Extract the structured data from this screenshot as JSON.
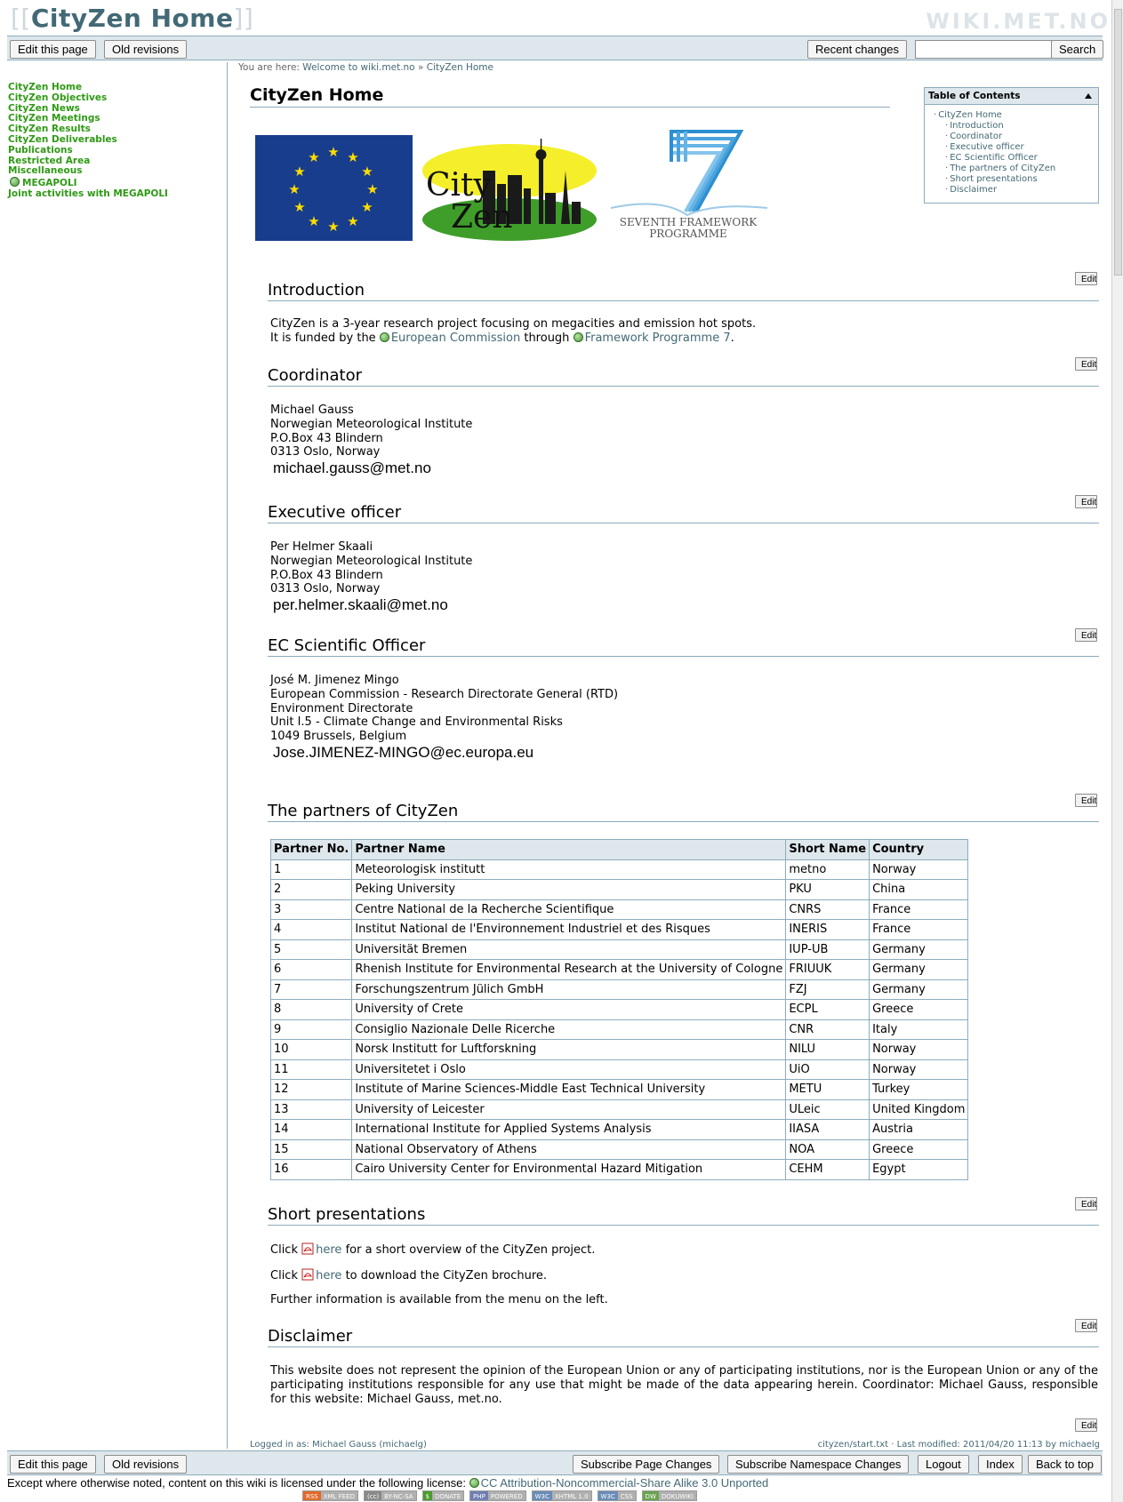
{
  "header": {
    "title_brackets_open": "[[",
    "title": "CityZen Home",
    "title_brackets_close": "]]",
    "brand": "WIKI.MET.NO"
  },
  "toolbar_top": {
    "edit_page": "Edit this page",
    "old_revisions": "Old revisions",
    "recent_changes": "Recent changes",
    "search_value": "",
    "search_button": "Search"
  },
  "breadcrumb": {
    "prefix": "You are here:",
    "items": [
      "Welcome to wiki.met.no",
      "CityZen Home"
    ],
    "separator": "»"
  },
  "sidebar": {
    "items": [
      {
        "label": "CityZen Home"
      },
      {
        "label": "CityZen Objectives"
      },
      {
        "label": "CityZen News"
      },
      {
        "label": "CityZen Meetings"
      },
      {
        "label": "CityZen Results"
      },
      {
        "label": "CityZen Deliverables"
      },
      {
        "label": "Publications"
      },
      {
        "label": "Restricted Area"
      },
      {
        "label": "Miscellaneous"
      },
      {
        "label": "MEGAPOLI",
        "external": true
      },
      {
        "label": "Joint activities with MEGAPOLI"
      }
    ]
  },
  "page": {
    "heading": "CityZen Home",
    "logos": {
      "cityzen_line1": "City",
      "cityzen_line2": "Zen",
      "fp7_line1": "SEVENTH FRAMEWORK",
      "fp7_line2": "PROGRAMME"
    }
  },
  "toc": {
    "title": "Table of Contents",
    "items": [
      "CityZen Home",
      "Introduction",
      "Coordinator",
      "Executive officer",
      "EC Scientific Officer",
      "The partners of CityZen",
      "Short presentations",
      "Disclaimer"
    ]
  },
  "edit_label": "Edit",
  "introduction": {
    "heading": "Introduction",
    "line1": "CityZen is a 3-year research project focusing on megacities and emission hot spots.",
    "line2_a": "It is funded by the",
    "link1": "European Commission",
    "line2_b": "through",
    "link2": "Framework Programme 7",
    "line2_c": "."
  },
  "coordinator": {
    "heading": "Coordinator",
    "lines": [
      "Michael Gauss",
      "Norwegian Meteorological Institute",
      "P.O.Box 43 Blindern",
      "0313 Oslo, Norway"
    ],
    "email": "michael.gauss@met.no"
  },
  "executive": {
    "heading": "Executive officer",
    "lines": [
      "Per Helmer Skaali",
      "Norwegian Meteorological Institute",
      "P.O.Box 43 Blindern",
      "0313 Oslo, Norway"
    ],
    "email": "per.helmer.skaali@met.no"
  },
  "ec_officer": {
    "heading": "EC Scientific Officer",
    "lines": [
      "José M. Jimenez Mingo",
      "European Commission - Research Directorate General (RTD)",
      "Environment Directorate",
      "Unit I.5 - Climate Change and Environmental Risks",
      "1049 Brussels, Belgium"
    ],
    "email": "Jose.JIMENEZ-MINGO@ec.europa.eu"
  },
  "partners": {
    "heading": "The partners of CityZen",
    "columns": [
      "Partner No.",
      "Partner Name",
      "Short Name",
      "Country"
    ],
    "rows": [
      [
        "1",
        "Meteorologisk institutt",
        "metno",
        "Norway"
      ],
      [
        "2",
        "Peking University",
        "PKU",
        "China"
      ],
      [
        "3",
        "Centre National de la Recherche Scientifique",
        "CNRS",
        "France"
      ],
      [
        "4",
        "Institut National de l'Environnement Industriel et des Risques",
        "INERIS",
        "France"
      ],
      [
        "5",
        "Universität Bremen",
        "IUP-UB",
        "Germany"
      ],
      [
        "6",
        "Rhenish Institute for Environmental Research at the University of Cologne",
        "FRIUUK",
        "Germany"
      ],
      [
        "7",
        "Forschungszentrum Jülich GmbH",
        "FZJ",
        "Germany"
      ],
      [
        "8",
        "University of Crete",
        "ECPL",
        "Greece"
      ],
      [
        "9",
        "Consiglio Nazionale Delle Ricerche",
        "CNR",
        "Italy"
      ],
      [
        "10",
        "Norsk Institutt for Luftforskning",
        "NILU",
        "Norway"
      ],
      [
        "11",
        "Universitetet i Oslo",
        "UiO",
        "Norway"
      ],
      [
        "12",
        "Institute of Marine Sciences-Middle East Technical University",
        "METU",
        "Turkey"
      ],
      [
        "13",
        "University of Leicester",
        "ULeic",
        "United Kingdom"
      ],
      [
        "14",
        "International Institute for Applied Systems Analysis",
        "IIASA",
        "Austria"
      ],
      [
        "15",
        "National Observatory of Athens",
        "NOA",
        "Greece"
      ],
      [
        "16",
        "Cairo University Center for Environmental Hazard Mitigation",
        "CEHM",
        "Egypt"
      ]
    ]
  },
  "presentations": {
    "heading": "Short presentations",
    "p1_a": "Click",
    "p1_link": "here",
    "p1_b": "for a short overview of the CityZen project.",
    "p2_a": "Click",
    "p2_link": "here",
    "p2_b": "to download the CityZen brochure.",
    "p3": "Further information is available from the menu on the left."
  },
  "disclaimer": {
    "heading": "Disclaimer",
    "text": "This website does not represent the opinion of the European Union or any of participating institutions, nor is the European Union or any of the participating institutions responsible for any use that might be made of the data appearing herein. Coordinator: Michael Gauss, responsible for this website: Michael Gauss, met.no."
  },
  "meta": {
    "logged_in": "Logged in as: Michael Gauss (michaelg)",
    "last_modified": "cityzen/start.txt · Last modified: 2011/04/20 11:13 by michaelg"
  },
  "toolbar_bottom": {
    "edit_page": "Edit this page",
    "old_revisions": "Old revisions",
    "subscribe_page": "Subscribe Page Changes",
    "subscribe_ns": "Subscribe Namespace Changes",
    "logout": "Logout",
    "index": "Index",
    "back_to_top": "Back to top"
  },
  "license": {
    "text": "Except where otherwise noted, content on this wiki is licensed under the following license:",
    "link": "CC Attribution-Noncommercial-Share Alike 3.0 Unported"
  },
  "badges": [
    {
      "a": "RSS",
      "b": "XML FEED",
      "color": "#e06a2a"
    },
    {
      "a": "(cc)",
      "b": "BY-NC-SA",
      "color": "#8a8a8a"
    },
    {
      "a": "$",
      "b": "DONATE",
      "color": "#4b9c2e"
    },
    {
      "a": "PHP",
      "b": "POWERED",
      "color": "#6f7fb3"
    },
    {
      "a": "W3C",
      "b": "XHTML 1.0",
      "color": "#6a8cb8"
    },
    {
      "a": "W3C",
      "b": "CSS",
      "color": "#6a8cb8"
    },
    {
      "a": "DW",
      "b": "DOKUWIKI",
      "color": "#6aa34f"
    }
  ]
}
